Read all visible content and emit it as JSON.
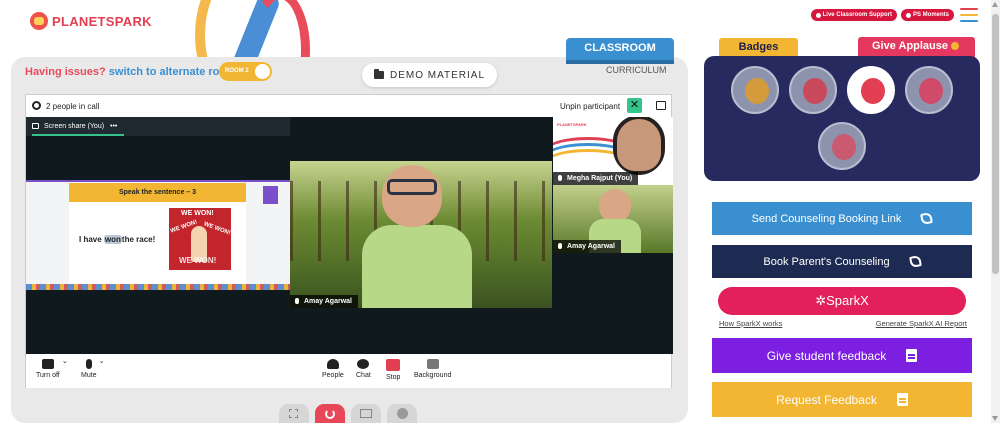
{
  "brand": {
    "name": "PLANETSPARK"
  },
  "top_buttons": [
    {
      "label": "Live Classroom Support"
    },
    {
      "label": "PS Moments"
    }
  ],
  "hamburger_colors": [
    "#e23f52",
    "#f2b633",
    "#3a8fd1"
  ],
  "tabs": {
    "classroom": "CLASSROOM",
    "curriculum": "CURRICULUM"
  },
  "issue": {
    "prefix": "Having issues?",
    "link": "switch to alternate room"
  },
  "room_toggle": {
    "label": "ROOM 2",
    "on": true
  },
  "demo_material": {
    "label": "DEMO MATERIAL"
  },
  "call": {
    "people_count": "2 people in call",
    "unpin_label": "Unpin participant",
    "screen_share_label": "Screen share (You)",
    "screen_share_more": "•••",
    "slide": {
      "title": "Speak the sentence – 3",
      "sentence_before": "I have",
      "sentence_highlight": "won",
      "sentence_after": "the race!",
      "image_texts": [
        "WE WON!",
        "WE WON!",
        "WE WON!",
        "WE WON!"
      ]
    },
    "main_video_name": "Amay Agarwal",
    "thumbnails": [
      {
        "name": "Megha Rajput (You)",
        "logo": "PLANETSPARK"
      },
      {
        "name": "Amay Agarwal"
      }
    ],
    "controls": {
      "left": [
        {
          "label": "Turn off",
          "icon": "camera-icon"
        },
        {
          "label": "Mute",
          "icon": "mic-icon"
        }
      ],
      "center": [
        {
          "label": "People",
          "icon": "people-icon"
        },
        {
          "label": "Chat",
          "icon": "chat-icon"
        },
        {
          "label": "Stop",
          "icon": "stop-share-icon"
        },
        {
          "label": "Background",
          "icon": "background-icon"
        }
      ]
    }
  },
  "right_panel": {
    "badges_tab": "Badges",
    "applause_tab": "Give Applause",
    "badge_icons": [
      "trophy-badge-icon",
      "robot-badge-icon",
      "star-badge-icon",
      "presenter-badge-icon",
      "reader-badge-icon"
    ],
    "active_badge_index": 2,
    "buttons": [
      {
        "label": "Send Counseling Booking Link",
        "color": "#3a8fd1",
        "icon": "phone-icon"
      },
      {
        "label": "Book Parent's Counseling",
        "color": "#1d2a52",
        "icon": "phone-icon"
      },
      {
        "label": "Give student feedback",
        "color": "#7c1fe0",
        "icon": "clipboard-icon"
      },
      {
        "label": "Request Feedback",
        "color": "#f2b633",
        "icon": "document-icon"
      }
    ],
    "sparkx": {
      "label": "SparkX",
      "link_left": "How SparkX works",
      "link_right": "Generate SparkX AI Report"
    }
  },
  "colors": {
    "accent_red": "#e4385e",
    "accent_blue": "#3a8fd1",
    "accent_yellow": "#f2b633",
    "navy": "#262a5e"
  }
}
